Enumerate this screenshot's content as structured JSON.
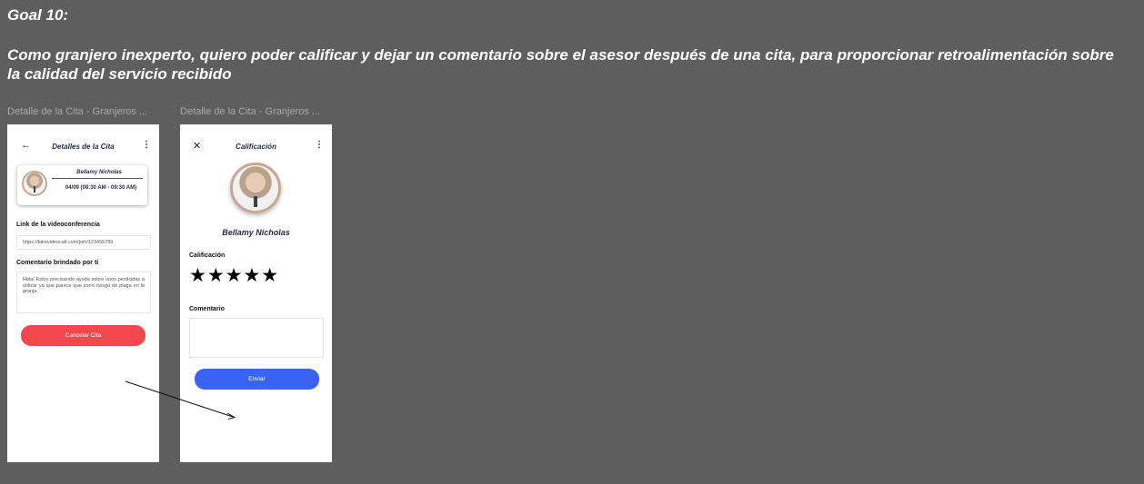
{
  "goal": {
    "title": "Goal 10:",
    "text": "Como granjero inexperto, quiero poder calificar y dejar un comentario sobre el asesor después de una cita, para proporcionar retroalimentación sobre la calidad del servicio recibido"
  },
  "frames": [
    {
      "label": "Detalle de la Cita - Granjeros ...",
      "header": {
        "back_icon": "←",
        "title": "Detalles de la Cita",
        "menu_icon": "⋮"
      },
      "card": {
        "name": "Bellamy Nicholas",
        "time": "04/09 (08:30 AM - 09:30 AM)"
      },
      "link_label": "Link de la videoconferencia",
      "link_value": "https://fakevideocall.com/join/123456789",
      "comment_label": "Comentario brindado por ti",
      "comment_value": "Hola! Estoy precisando ayuda sobre unos pesticidas a utilizar ya que parece que corro riesgo de plaga en la granja.",
      "cancel_button": "Cancelar Cita"
    },
    {
      "label": "Detalle de la Cita - Granjeros ...",
      "header": {
        "close_icon": "✕",
        "title": "Calificación",
        "menu_icon": "⋮"
      },
      "name": "Bellamy Nicholas",
      "rating_label": "Calificación",
      "stars": "★★★★★",
      "comment_label": "Comentario",
      "send_button": "Enviar"
    }
  ],
  "colors": {
    "background": "#5e5e5e",
    "cancel": "#f2484d",
    "send": "#3b63f3",
    "title": "#1f2a44"
  }
}
